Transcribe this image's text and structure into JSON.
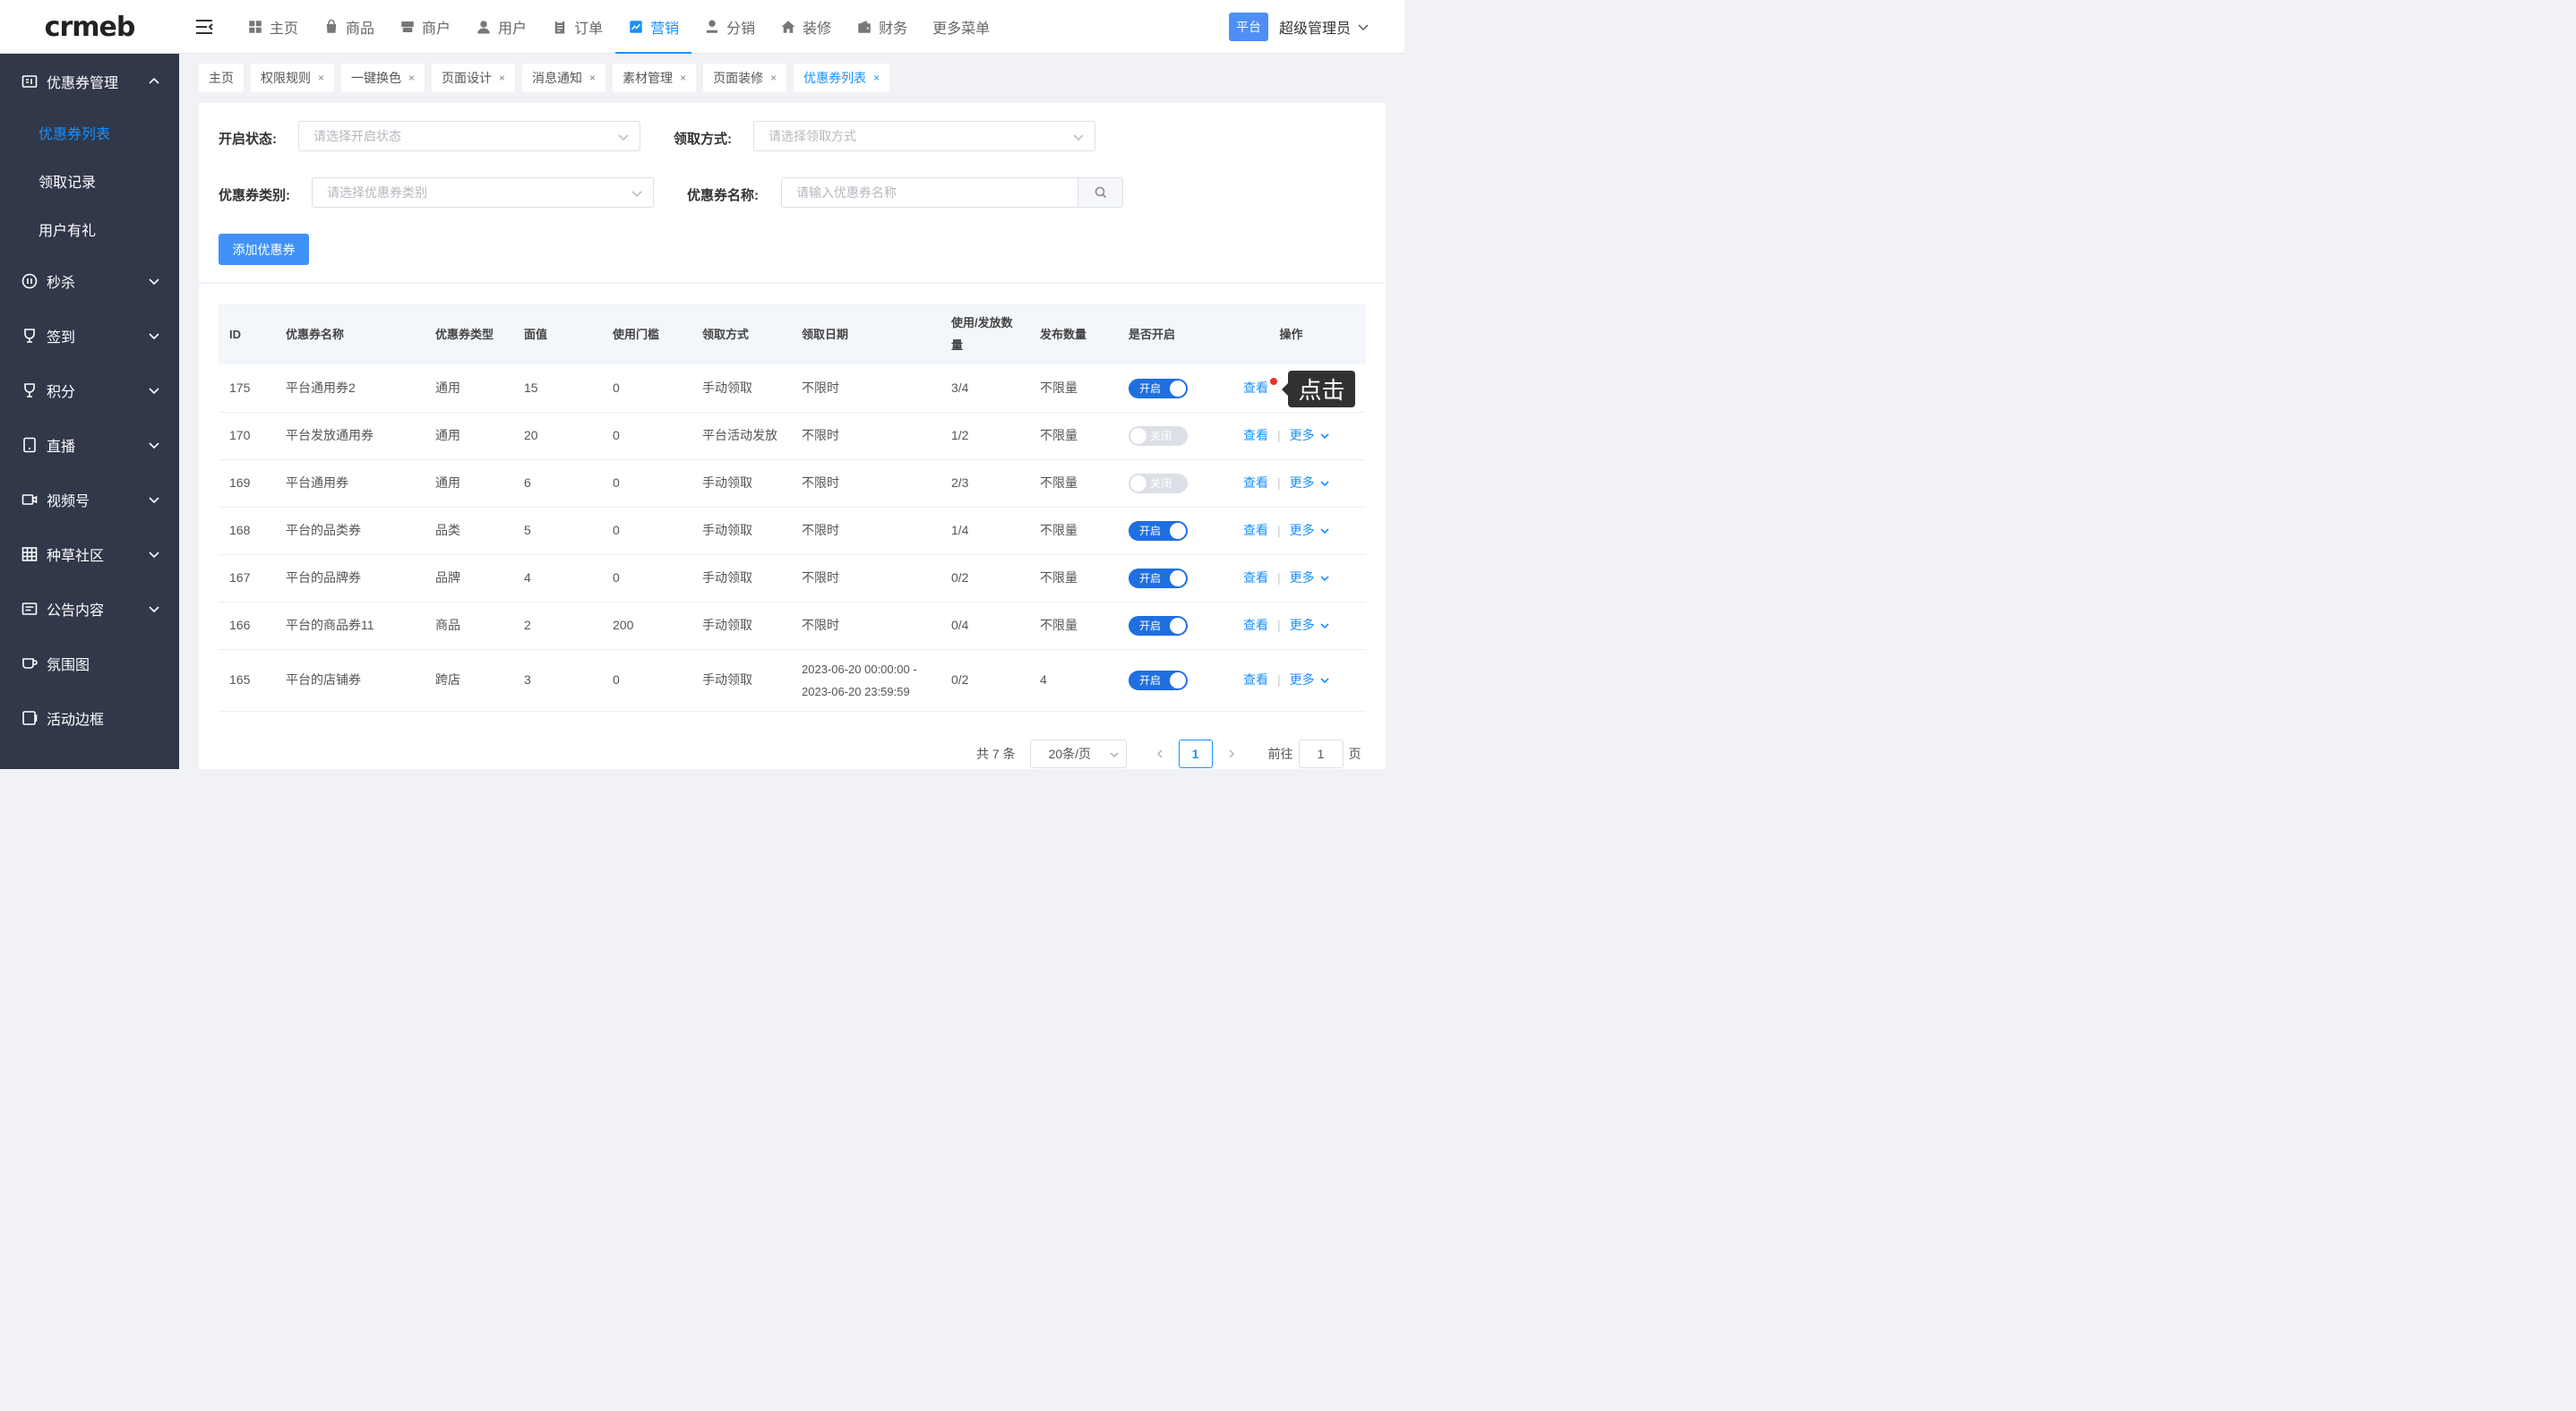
{
  "header": {
    "logo": "crmeb",
    "nav": [
      {
        "label": "主页",
        "icon": "home-grid-icon"
      },
      {
        "label": "商品",
        "icon": "bag-icon"
      },
      {
        "label": "商户",
        "icon": "store-icon"
      },
      {
        "label": "用户",
        "icon": "user-icon"
      },
      {
        "label": "订单",
        "icon": "clipboard-icon"
      },
      {
        "label": "营销",
        "icon": "chart-icon",
        "active": true
      },
      {
        "label": "分销",
        "icon": "distribution-icon"
      },
      {
        "label": "装修",
        "icon": "house-icon"
      },
      {
        "label": "财务",
        "icon": "wallet-icon"
      },
      {
        "label": "更多菜单",
        "icon": ""
      }
    ],
    "platform_badge": "平台",
    "admin_name": "超级管理员"
  },
  "sidebar": {
    "groups": [
      {
        "label": "优惠券管理",
        "icon": "coupon-icon",
        "expanded": true,
        "items": [
          {
            "label": "优惠券列表",
            "active": true
          },
          {
            "label": "领取记录"
          },
          {
            "label": "用户有礼"
          }
        ]
      },
      {
        "label": "秒杀",
        "icon": "clock-icon"
      },
      {
        "label": "签到",
        "icon": "trophy-icon"
      },
      {
        "label": "积分",
        "icon": "medal-icon"
      },
      {
        "label": "直播",
        "icon": "tablet-icon"
      },
      {
        "label": "视频号",
        "icon": "video-icon"
      },
      {
        "label": "种草社区",
        "icon": "grid-icon"
      },
      {
        "label": "公告内容",
        "icon": "notice-icon"
      },
      {
        "label": "氛围图",
        "icon": "cup-icon"
      },
      {
        "label": "活动边框",
        "icon": "frame-icon"
      }
    ]
  },
  "tabs": [
    {
      "label": "主页",
      "closable": false
    },
    {
      "label": "权限规则",
      "closable": true
    },
    {
      "label": "一键换色",
      "closable": true
    },
    {
      "label": "页面设计",
      "closable": true
    },
    {
      "label": "消息通知",
      "closable": true
    },
    {
      "label": "素材管理",
      "closable": true
    },
    {
      "label": "页面装修",
      "closable": true
    },
    {
      "label": "优惠券列表",
      "closable": true,
      "active": true
    }
  ],
  "tab_close_glyph": "×",
  "filters": {
    "status_label": "开启状态:",
    "status_placeholder": "请选择开启状态",
    "method_label": "领取方式:",
    "method_placeholder": "请选择领取方式",
    "category_label": "优惠券类别:",
    "category_placeholder": "请选择优惠券类别",
    "name_label": "优惠券名称:",
    "name_placeholder": "请输入优惠券名称",
    "add_button": "添加优惠券"
  },
  "table": {
    "columns": [
      "ID",
      "优惠券名称",
      "优惠券类型",
      "面值",
      "使用门槛",
      "领取方式",
      "领取日期",
      "使用/发放数量",
      "发布数量",
      "是否开启",
      "操作"
    ],
    "rows": [
      {
        "id": "175",
        "name": "平台通用券2",
        "type": "通用",
        "value": "15",
        "threshold": "0",
        "method": "手动领取",
        "date": "不限时",
        "usage": "3/4",
        "quantity": "不限量",
        "enabled": true
      },
      {
        "id": "170",
        "name": "平台发放通用券",
        "type": "通用",
        "value": "20",
        "threshold": "0",
        "method": "平台活动发放",
        "date": "不限时",
        "usage": "1/2",
        "quantity": "不限量",
        "enabled": false
      },
      {
        "id": "169",
        "name": "平台通用券",
        "type": "通用",
        "value": "6",
        "threshold": "0",
        "method": "手动领取",
        "date": "不限时",
        "usage": "2/3",
        "quantity": "不限量",
        "enabled": false
      },
      {
        "id": "168",
        "name": "平台的品类券",
        "type": "品类",
        "value": "5",
        "threshold": "0",
        "method": "手动领取",
        "date": "不限时",
        "usage": "1/4",
        "quantity": "不限量",
        "enabled": true
      },
      {
        "id": "167",
        "name": "平台的品牌券",
        "type": "品牌",
        "value": "4",
        "threshold": "0",
        "method": "手动领取",
        "date": "不限时",
        "usage": "0/2",
        "quantity": "不限量",
        "enabled": true
      },
      {
        "id": "166",
        "name": "平台的商品券11",
        "type": "商品",
        "value": "2",
        "threshold": "200",
        "method": "手动领取",
        "date": "不限时",
        "usage": "0/4",
        "quantity": "不限量",
        "enabled": true
      },
      {
        "id": "165",
        "name": "平台的店铺券",
        "type": "跨店",
        "value": "3",
        "threshold": "0",
        "method": "手动领取",
        "date": "2023-06-20 00:00:00 -",
        "date2": "2023-06-20 23:59:59",
        "usage": "0/2",
        "quantity": "4",
        "enabled": true
      }
    ],
    "toggle_on": "开启",
    "toggle_off": "关闭",
    "view_label": "查看",
    "more_label": "更多"
  },
  "tooltip": "点击",
  "pagination": {
    "total": "共 7 条",
    "page_size": "20条/页",
    "current_page": "1",
    "goto_label": "前往",
    "goto_value": "1",
    "page_suffix": "页"
  },
  "colors": {
    "accent": "#1890ff",
    "sidebar_bg": "#30384a",
    "toggle_on": "#1f6fe0",
    "toggle_off": "#dcdfe6",
    "indicator_dot": "#e5322d"
  }
}
